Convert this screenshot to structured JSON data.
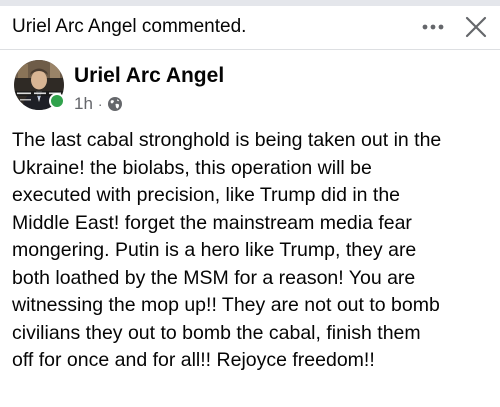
{
  "header": {
    "title": "Uriel Arc Angel commented."
  },
  "post": {
    "author": "Uriel Arc Angel",
    "time": "1h",
    "separator": "·",
    "lines": [
      "The last cabal stronghold is being taken out in the",
      "Ukraine! the biolabs, this operation will be",
      "executed with precision, like Trump did in the",
      "Middle East! forget the mainstream media fear",
      "mongering. Putin is a hero like Trump, they are",
      "both loathed by the MSM for a reason! You are",
      "witnessing the mop up!! They are not out to bomb",
      "civilians they out to bomb the cabal, finish them",
      "off for once and for all!! Rejoyce freedom!!"
    ]
  },
  "icons": {
    "more": "more-horizontal-icon",
    "close": "close-icon",
    "privacy": "globe-icon"
  },
  "colors": {
    "online": "#31a24c",
    "meta_text": "#65676b",
    "primary_text": "#050505"
  }
}
